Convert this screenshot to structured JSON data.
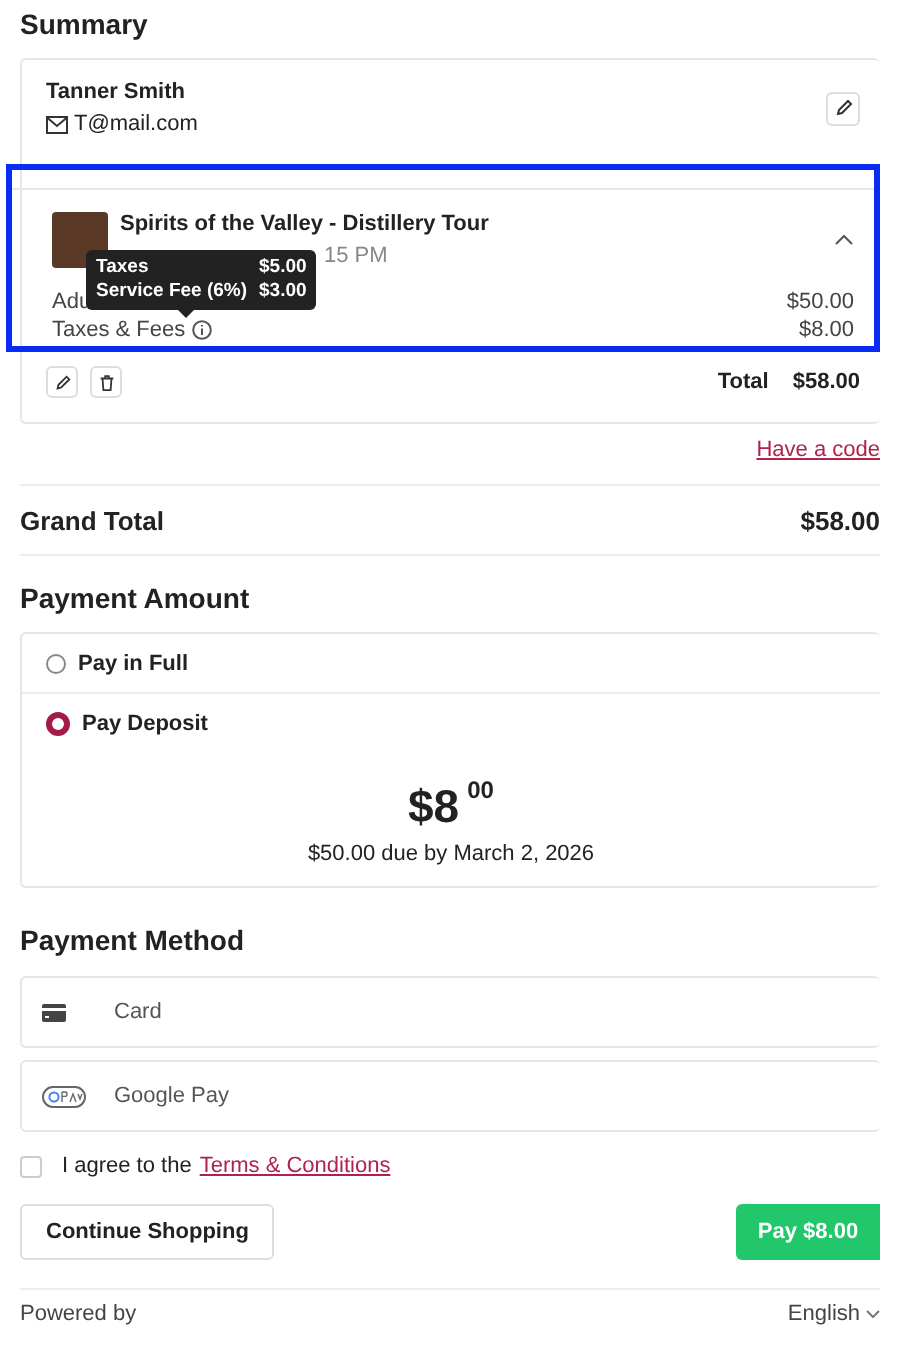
{
  "summary": {
    "title": "Summary",
    "customer": {
      "name": "Tanner Smith",
      "email": "T@mail.com"
    },
    "item": {
      "title": "Spirits of the Valley - Distillery Tour",
      "date_fragment": "15 PM",
      "expanded": true,
      "lines": [
        {
          "label": "Adu",
          "amount": "$50.00",
          "info": false
        },
        {
          "label": "Taxes & Fees",
          "amount": "$8.00",
          "info": true
        }
      ],
      "tooltip": [
        {
          "label": "Taxes",
          "amount": "$5.00"
        },
        {
          "label": "Service Fee (6%)",
          "amount": "$3.00"
        }
      ],
      "total_label": "Total",
      "total": "$58.00"
    },
    "code_link": "Have a code"
  },
  "grand_total": {
    "label": "Grand Total",
    "amount": "$58.00"
  },
  "payment_amount": {
    "title": "Payment Amount",
    "options": [
      {
        "label": "Pay in Full",
        "selected": false
      },
      {
        "label": "Pay Deposit",
        "selected": true,
        "amount_whole": "$8",
        "amount_cents": "00",
        "note": "$50.00 due by March 2, 2026"
      }
    ]
  },
  "payment_method": {
    "title": "Payment Method",
    "methods": [
      {
        "kind": "card",
        "label": "Card"
      },
      {
        "kind": "gpay",
        "label": "Google Pay"
      }
    ]
  },
  "agree": {
    "checked": false,
    "text": "I agree to the",
    "link": "Terms & Conditions"
  },
  "buttons": {
    "continue": "Continue Shopping",
    "pay": "Pay $8.00"
  },
  "footer": {
    "powered": "Powered by",
    "language": "English"
  }
}
